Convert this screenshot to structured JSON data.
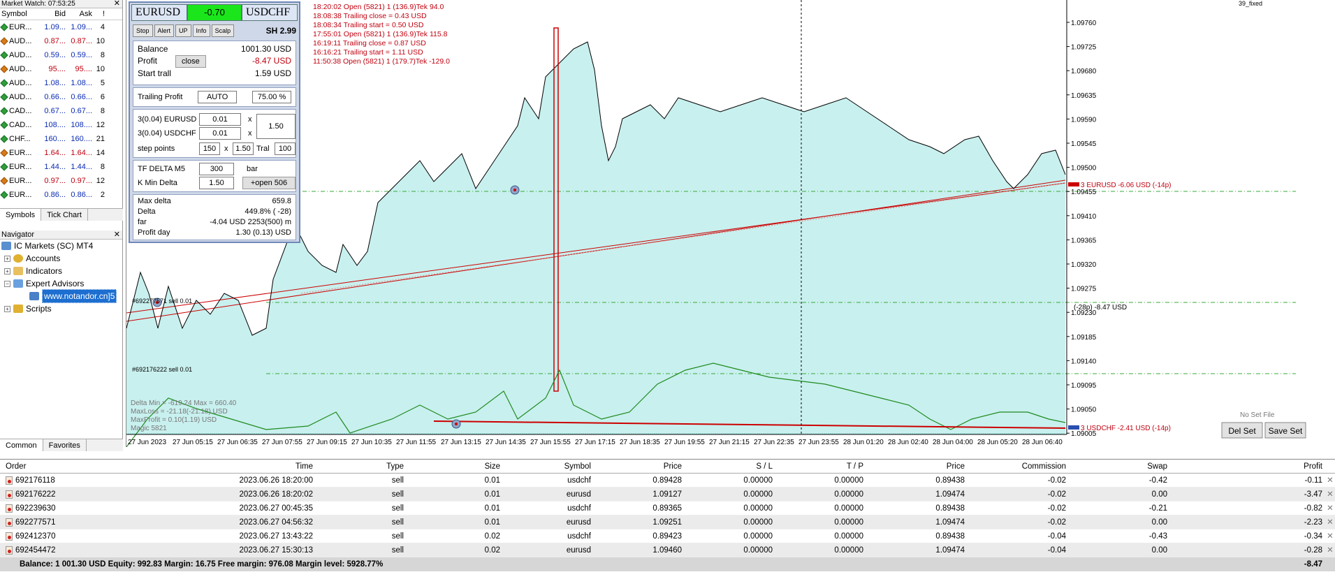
{
  "market_watch": {
    "title": "Market Watch: 07:53:25",
    "headers": [
      "Symbol",
      "Bid",
      "Ask",
      "!"
    ],
    "rows": [
      {
        "sym": "EUR...",
        "bid": "1.09...",
        "ask": "1.09...",
        "n": "4",
        "dir": "up",
        "color": "blue"
      },
      {
        "sym": "AUD...",
        "bid": "0.87...",
        "ask": "0.87...",
        "n": "10",
        "dir": "dn",
        "color": "red"
      },
      {
        "sym": "AUD...",
        "bid": "0.59...",
        "ask": "0.59...",
        "n": "8",
        "dir": "up",
        "color": "blue"
      },
      {
        "sym": "AUD...",
        "bid": "95....",
        "ask": "95....",
        "n": "10",
        "dir": "dn",
        "color": "red"
      },
      {
        "sym": "AUD...",
        "bid": "1.08...",
        "ask": "1.08...",
        "n": "5",
        "dir": "up",
        "color": "blue"
      },
      {
        "sym": "AUD...",
        "bid": "0.66...",
        "ask": "0.66...",
        "n": "6",
        "dir": "up",
        "color": "blue"
      },
      {
        "sym": "CAD...",
        "bid": "0.67...",
        "ask": "0.67...",
        "n": "8",
        "dir": "up",
        "color": "blue"
      },
      {
        "sym": "CAD...",
        "bid": "108....",
        "ask": "108....",
        "n": "12",
        "dir": "up",
        "color": "blue"
      },
      {
        "sym": "CHF...",
        "bid": "160....",
        "ask": "160....",
        "n": "21",
        "dir": "up",
        "color": "blue"
      },
      {
        "sym": "EUR...",
        "bid": "1.64...",
        "ask": "1.64...",
        "n": "14",
        "dir": "dn",
        "color": "red"
      },
      {
        "sym": "EUR...",
        "bid": "1.44...",
        "ask": "1.44...",
        "n": "8",
        "dir": "up",
        "color": "blue"
      },
      {
        "sym": "EUR...",
        "bid": "0.97...",
        "ask": "0.97...",
        "n": "12",
        "dir": "dn",
        "color": "red"
      },
      {
        "sym": "EUR...",
        "bid": "0.86...",
        "ask": "0.86...",
        "n": "2",
        "dir": "up",
        "color": "blue"
      }
    ],
    "tabs": [
      "Symbols",
      "Tick Chart"
    ]
  },
  "navigator": {
    "title": "Navigator",
    "items": [
      "IC Markets (SC) MT4",
      "Accounts",
      "Indicators",
      "Expert Advisors",
      "www.notandor.cn]5",
      "Scripts"
    ],
    "tabs": [
      "Common",
      "Favorites"
    ]
  },
  "ea_panel": {
    "sym1": "EURUSD",
    "value": "-0.70",
    "sym2": "USDCHF",
    "buttons": [
      "Stop",
      "Alert",
      "UP",
      "Info",
      "Scalp"
    ],
    "sh": "SH 2.99",
    "balance_label": "Balance",
    "balance": "1001.30 USD",
    "profit_label": "Profit",
    "close_label": "close",
    "profit": "-8.47 USD",
    "start_trall_label": "Start trall",
    "start_trall": "1.59 USD",
    "trailing_label": "Trailing Profit",
    "trailing_mode": "AUTO",
    "trailing_pct": "75.00 %",
    "lot1_label": "3(0.04) EURUSD",
    "lot1": "0.01",
    "lot2_label": "3(0.04) USDCHF",
    "lot2": "0.01",
    "x": "x",
    "mult": "1.50",
    "step_label": "step points",
    "step": "150",
    "step_mult": "1.50",
    "tral_label": "Tral",
    "tral": "100",
    "tf_label": "TF DELTA M5",
    "tf": "300",
    "bar_label": "bar",
    "kmin_label": "K Min Delta",
    "kmin": "1.50",
    "open_btn": "+open 506",
    "maxdelta_label": "Max delta",
    "maxdelta": "659.8",
    "delta_label": "Delta",
    "delta": "449.8%  ( -28)",
    "far_label": "far",
    "far": "-4.04 USD  2253(500) m",
    "profitday_label": "Profit day",
    "profitday": "1.30  (0.13) USD"
  },
  "log": [
    "18:20:02  Open (5821) 1 (136.9)Tek 94.0",
    "18:08:38  Trailing close = 0.43 USD",
    "18:08:34  Trailing start = 0.50 USD",
    "17:55:01  Open (5821) 1 (136.9)Tek 115.8",
    "16:19:11  Trailing close = 0.87 USD",
    "16:16:21  Trailing start = 1.11 USD",
    "11:50:38  Open (5821) 1 (179.7)Tek -129.0"
  ],
  "chart": {
    "corner_label": "39_fixed",
    "price_ticks": [
      "1.09760",
      "1.09725",
      "1.09680",
      "1.09635",
      "1.09590",
      "1.09545",
      "1.09500",
      "1.09455",
      "1.09410",
      "1.09365",
      "1.09320",
      "1.09275",
      "1.09230",
      "1.09185",
      "1.09140",
      "1.09095",
      "1.09050",
      "1.09005"
    ],
    "time_ticks": [
      "27 Jun 2023",
      "27 Jun 05:15",
      "27 Jun 06:35",
      "27 Jun 07:55",
      "27 Jun 09:15",
      "27 Jun 10:35",
      "27 Jun 11:55",
      "27 Jun 13:15",
      "27 Jun 14:35",
      "27 Jun 15:55",
      "27 Jun 17:15",
      "27 Jun 18:35",
      "27 Jun 19:55",
      "27 Jun 21:15",
      "27 Jun 22:35",
      "27 Jun 23:55",
      "28 Jun 01:20",
      "28 Jun 02:40",
      "28 Jun 04:00",
      "28 Jun 05:20",
      "28 Jun 06:40"
    ],
    "label_eurusd": "3 EURUSD -6.06 USD  (-14p)",
    "label_usdchf": "3 USDCHF -2.41 USD  (-14p)",
    "label_total": "(-28p) -8.47 USD",
    "order_label1": "#692277571 sell 0.01",
    "order_label2": "#692176222 sell 0.01",
    "info_lines": [
      "Delta Min = -619.24  Max = 660.40",
      "MaxLoss = -21.18(-21.18) USD",
      "MaxProfit = 0.10(1.19) USD",
      "Magic 5821"
    ],
    "no_set_file": "No Set File",
    "del_set": "Del Set",
    "save_set": "Save Set"
  },
  "terminal": {
    "headers": [
      "Order",
      "Time",
      "Type",
      "Size",
      "Symbol",
      "Price",
      "S / L",
      "T / P",
      "Price",
      "Commission",
      "Swap",
      "Profit"
    ],
    "rows": [
      [
        "692176118",
        "2023.06.26 18:20:00",
        "sell",
        "0.01",
        "usdchf",
        "0.89428",
        "0.00000",
        "0.00000",
        "0.89438",
        "-0.02",
        "-0.42",
        "-0.11"
      ],
      [
        "692176222",
        "2023.06.26 18:20:02",
        "sell",
        "0.01",
        "eurusd",
        "1.09127",
        "0.00000",
        "0.00000",
        "1.09474",
        "-0.02",
        "0.00",
        "-3.47"
      ],
      [
        "692239630",
        "2023.06.27 00:45:35",
        "sell",
        "0.01",
        "usdchf",
        "0.89365",
        "0.00000",
        "0.00000",
        "0.89438",
        "-0.02",
        "-0.21",
        "-0.82"
      ],
      [
        "692277571",
        "2023.06.27 04:56:32",
        "sell",
        "0.01",
        "eurusd",
        "1.09251",
        "0.00000",
        "0.00000",
        "1.09474",
        "-0.02",
        "0.00",
        "-2.23"
      ],
      [
        "692412370",
        "2023.06.27 13:43:22",
        "sell",
        "0.02",
        "usdchf",
        "0.89423",
        "0.00000",
        "0.00000",
        "0.89438",
        "-0.04",
        "-0.43",
        "-0.34"
      ],
      [
        "692454472",
        "2023.06.27 15:30:13",
        "sell",
        "0.02",
        "eurusd",
        "1.09460",
        "0.00000",
        "0.00000",
        "1.09474",
        "-0.04",
        "0.00",
        "-0.28"
      ]
    ],
    "balance_line": "Balance: 1 001.30 USD  Equity: 992.83  Margin: 16.75  Free margin: 976.08  Margin level: 5928.77%",
    "total_profit": "-8.47"
  },
  "colors": {
    "panel_border": "#6f87b7",
    "value_bg": "#1be51b",
    "area": "#c8f0ee",
    "price_line": "#000000",
    "delta_line": "#1f8a1f",
    "red": "#c0000f"
  }
}
